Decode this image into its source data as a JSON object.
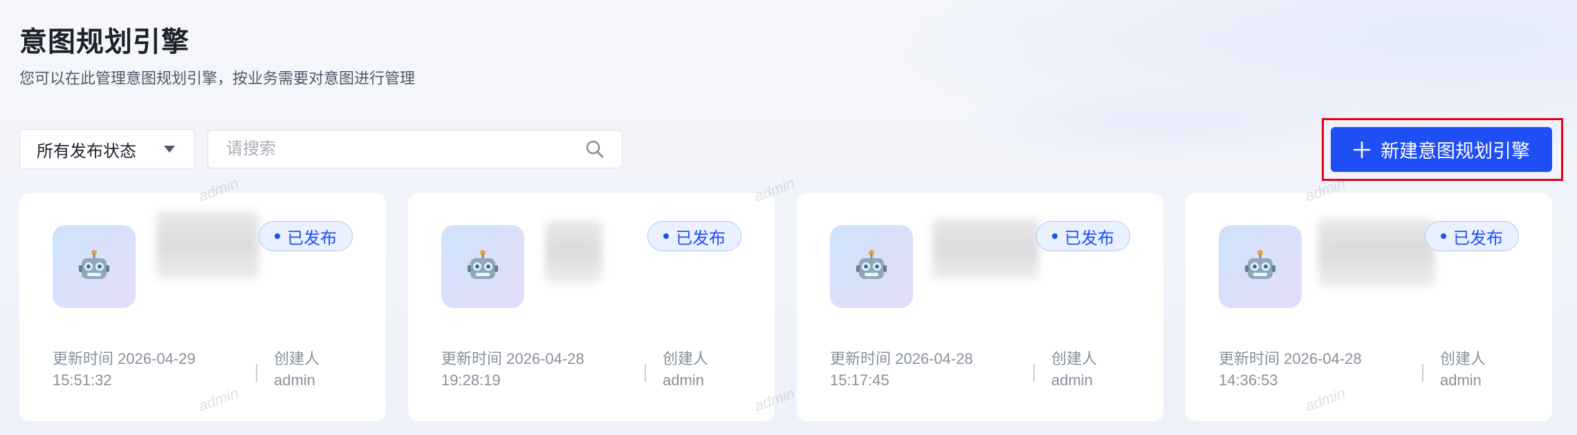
{
  "header": {
    "title": "意图规划引擎",
    "subtitle": "您可以在此管理意图规划引擎，按业务需要对意图进行管理"
  },
  "filters": {
    "status_select": "所有发布状态",
    "search_placeholder": "请搜索",
    "create_button": "新建意图规划引擎"
  },
  "watermark_text": "admin",
  "cards": [
    {
      "status": "已发布",
      "updated_label": "更新时间 2026-04-29",
      "updated_time": "15:51:32",
      "creator_label": "创建人",
      "creator": "admin"
    },
    {
      "status": "已发布",
      "updated_label": "更新时间 2026-04-28",
      "updated_time": "19:28:19",
      "creator_label": "创建人",
      "creator": "admin"
    },
    {
      "status": "已发布",
      "updated_label": "更新时间 2026-04-28",
      "updated_time": "15:17:45",
      "creator_label": "创建人",
      "creator": "admin"
    },
    {
      "status": "已发布",
      "updated_label": "更新时间 2026-04-28",
      "updated_time": "14:36:53",
      "creator_label": "创建人",
      "creator": "admin"
    }
  ],
  "icons": {
    "search": "search-icon",
    "plus": "plus-icon",
    "caret": "caret-down-icon",
    "card_avatar": "robot-icon"
  },
  "colors": {
    "primary": "#1f4ef5",
    "highlight_border": "#e60012"
  }
}
